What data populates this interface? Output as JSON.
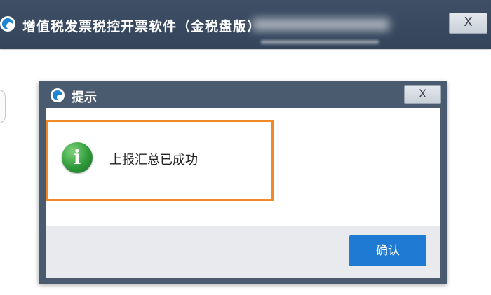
{
  "main_window": {
    "title": "增值税发票税控开票软件（金税盘版）",
    "close_label": "X"
  },
  "dialog": {
    "title": "提示",
    "close_label": "X",
    "message": "上报汇总已成功",
    "info_icon_glyph": "i",
    "ok_label": "确认"
  },
  "colors": {
    "titlebar": "#3b4b61",
    "dialog_frame": "#4a5a6f",
    "highlight_border": "#f08a24",
    "ok_button": "#1f7ad4",
    "info_icon": "#2e9a3a"
  },
  "icons": [
    "app-logo-icon",
    "info-icon",
    "close-icon"
  ]
}
